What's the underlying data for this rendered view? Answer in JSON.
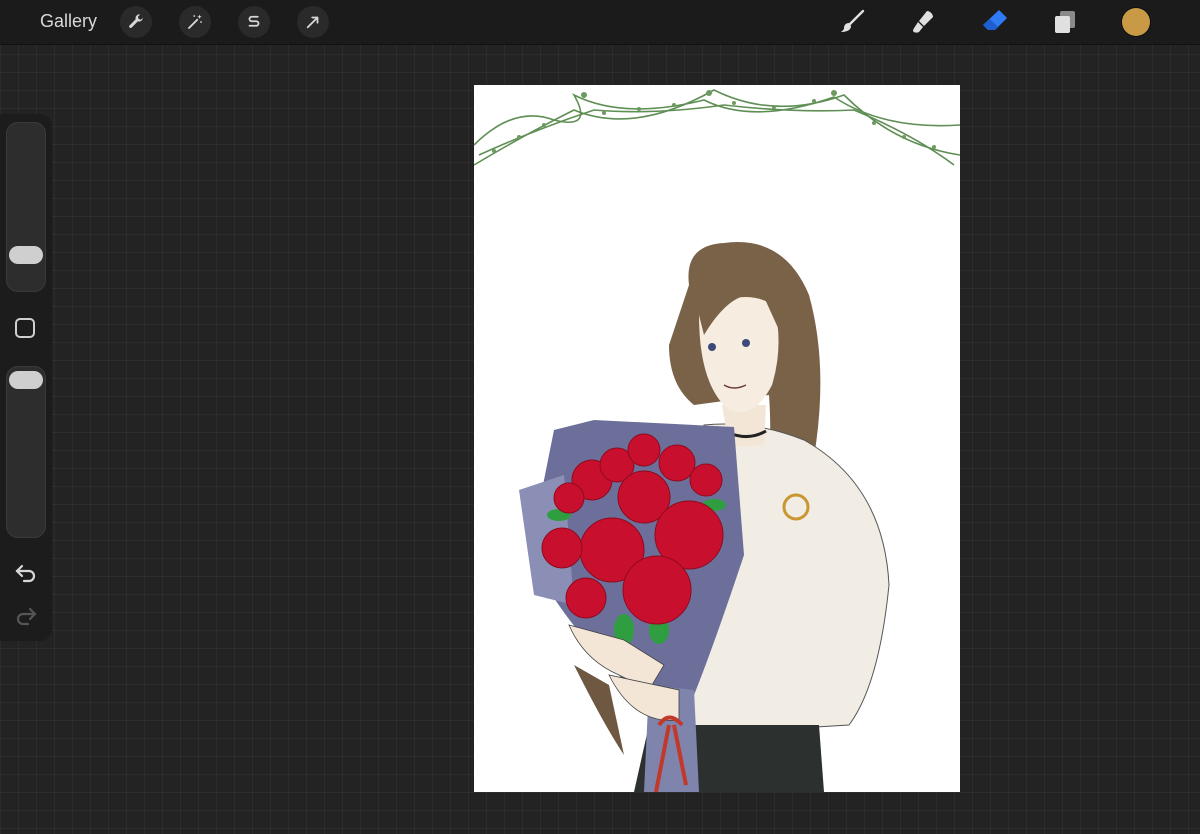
{
  "topbar": {
    "gallery_label": "Gallery",
    "actions": [
      {
        "icon": "wrench-icon",
        "name": "actions-button"
      },
      {
        "icon": "magic-wand-icon",
        "name": "adjustments-button"
      },
      {
        "icon": "selection-s-icon",
        "name": "selection-button"
      },
      {
        "icon": "arrow-transform-icon",
        "name": "transform-button"
      }
    ],
    "tools": [
      {
        "icon": "brush-icon",
        "name": "paint-tool"
      },
      {
        "icon": "smudge-icon",
        "name": "smudge-tool"
      },
      {
        "icon": "eraser-icon",
        "name": "eraser-tool",
        "active": true
      },
      {
        "icon": "layers-icon",
        "name": "layers-button"
      }
    ],
    "current_color": "#c99a45",
    "accent_color": "#2f7bf6"
  },
  "sidebar": {
    "brush_size_level": 0.15,
    "opacity_level": 1.0,
    "icons": [
      "square-icon",
      "undo-icon",
      "redo-icon"
    ]
  },
  "canvas": {
    "background": "#ffffff",
    "artwork": "illustration-of-person-holding-red-rose-bouquet-with-vine-garland"
  }
}
